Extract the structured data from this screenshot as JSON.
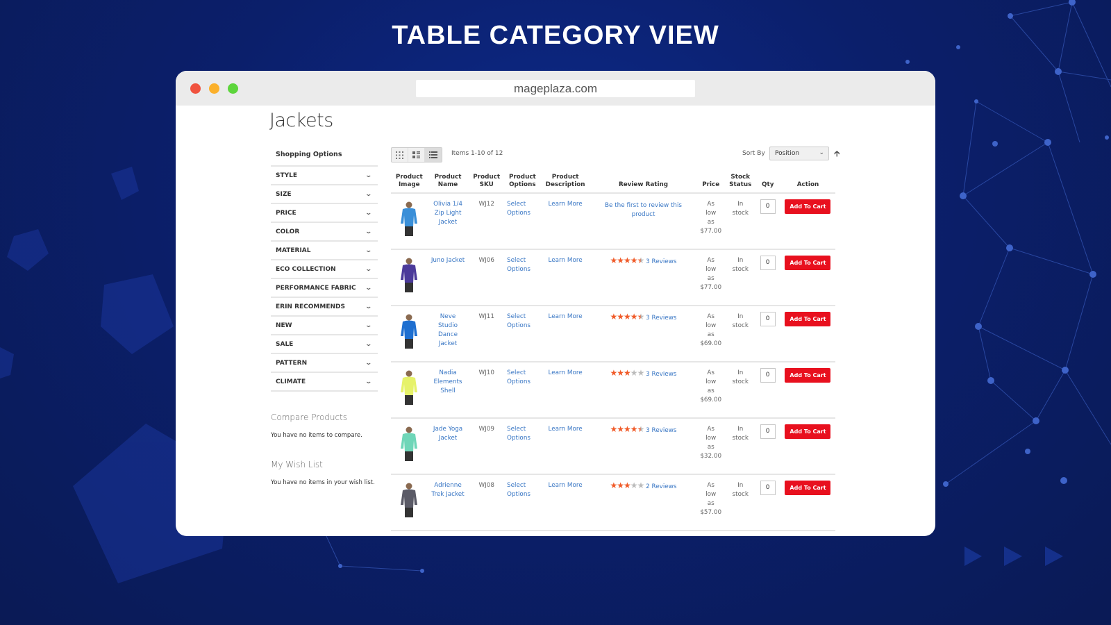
{
  "headline": "TABLE CATEGORY VIEW",
  "browser": {
    "url": "mageplaza.com"
  },
  "page": {
    "title": "Jackets"
  },
  "sidebar": {
    "title": "Shopping Options",
    "filters": [
      "STYLE",
      "SIZE",
      "PRICE",
      "COLOR",
      "MATERIAL",
      "ECO COLLECTION",
      "PERFORMANCE FABRIC",
      "ERIN RECOMMENDS",
      "NEW",
      "SALE",
      "PATTERN",
      "CLIMATE"
    ],
    "compare_title": "Compare Products",
    "compare_text": "You have no items to compare.",
    "wishlist_title": "My Wish List",
    "wishlist_text": "You have no items in your wish list."
  },
  "toolbar": {
    "view_modes": [
      "grid-view-icon",
      "compact-grid-view-icon",
      "table-view-icon"
    ],
    "active_mode": "table",
    "items_count": "Items 1-10 of 12",
    "sort_label": "Sort By",
    "sort_value": "Position",
    "sort_direction": "ascending"
  },
  "table": {
    "headers": {
      "image": [
        "Product",
        "Image"
      ],
      "name": [
        "Product",
        "Name"
      ],
      "sku": [
        "Product",
        "SKU"
      ],
      "options": [
        "Product",
        "Options"
      ],
      "description": [
        "Product",
        "Description"
      ],
      "rating": "Review Rating",
      "price": "Price",
      "stock": [
        "Stock",
        "Status"
      ],
      "qty": "Qty",
      "action": "Action"
    },
    "rows": [
      {
        "name": "Olivia 1/4 Zip Light Jacket",
        "sku": "WJ12",
        "options": "Select Options",
        "description": "Learn More",
        "rating": null,
        "reviews": "Be the first to review this product",
        "price_prefix": "As low as",
        "price": "$77.00",
        "stock": "In stock",
        "qty": "0",
        "action": "Add To Cart",
        "color": "#3a8fd8"
      },
      {
        "name": "Juno Jacket",
        "sku": "WJ06",
        "options": "Select Options",
        "description": "Learn More",
        "rating": 4.5,
        "reviews": "3 Reviews",
        "price_prefix": "As low as",
        "price": "$77.00",
        "stock": "In stock",
        "qty": "0",
        "action": "Add To Cart",
        "color": "#4b3a9a"
      },
      {
        "name": "Neve Studio Dance Jacket",
        "sku": "WJ11",
        "options": "Select Options",
        "description": "Learn More",
        "rating": 4.5,
        "reviews": "3 Reviews",
        "price_prefix": "As low as",
        "price": "$69.00",
        "stock": "In stock",
        "qty": "0",
        "action": "Add To Cart",
        "color": "#1e6fd0"
      },
      {
        "name": "Nadia Elements Shell",
        "sku": "WJ10",
        "options": "Select Options",
        "description": "Learn More",
        "rating": 3,
        "reviews": "3 Reviews",
        "price_prefix": "As low as",
        "price": "$69.00",
        "stock": "In stock",
        "qty": "0",
        "action": "Add To Cart",
        "color": "#e6f26a"
      },
      {
        "name": "Jade Yoga Jacket",
        "sku": "WJ09",
        "options": "Select Options",
        "description": "Learn More",
        "rating": 4.5,
        "reviews": "3 Reviews",
        "price_prefix": "As low as",
        "price": "$32.00",
        "stock": "In stock",
        "qty": "0",
        "action": "Add To Cart",
        "color": "#6fd6b8"
      },
      {
        "name": "Adrienne Trek Jacket",
        "sku": "WJ08",
        "options": "Select Options",
        "description": "Learn More",
        "rating": 3,
        "reviews": "2 Reviews",
        "price_prefix": "As low as",
        "price": "$57.00",
        "stock": "In stock",
        "qty": "0",
        "action": "Add To Cart",
        "color": "#5a5a66"
      }
    ]
  },
  "colors": {
    "accent_link": "#3876c4",
    "add_to_cart": "#e8101e",
    "star": "#f05a28",
    "background": "#0b1f6b"
  }
}
